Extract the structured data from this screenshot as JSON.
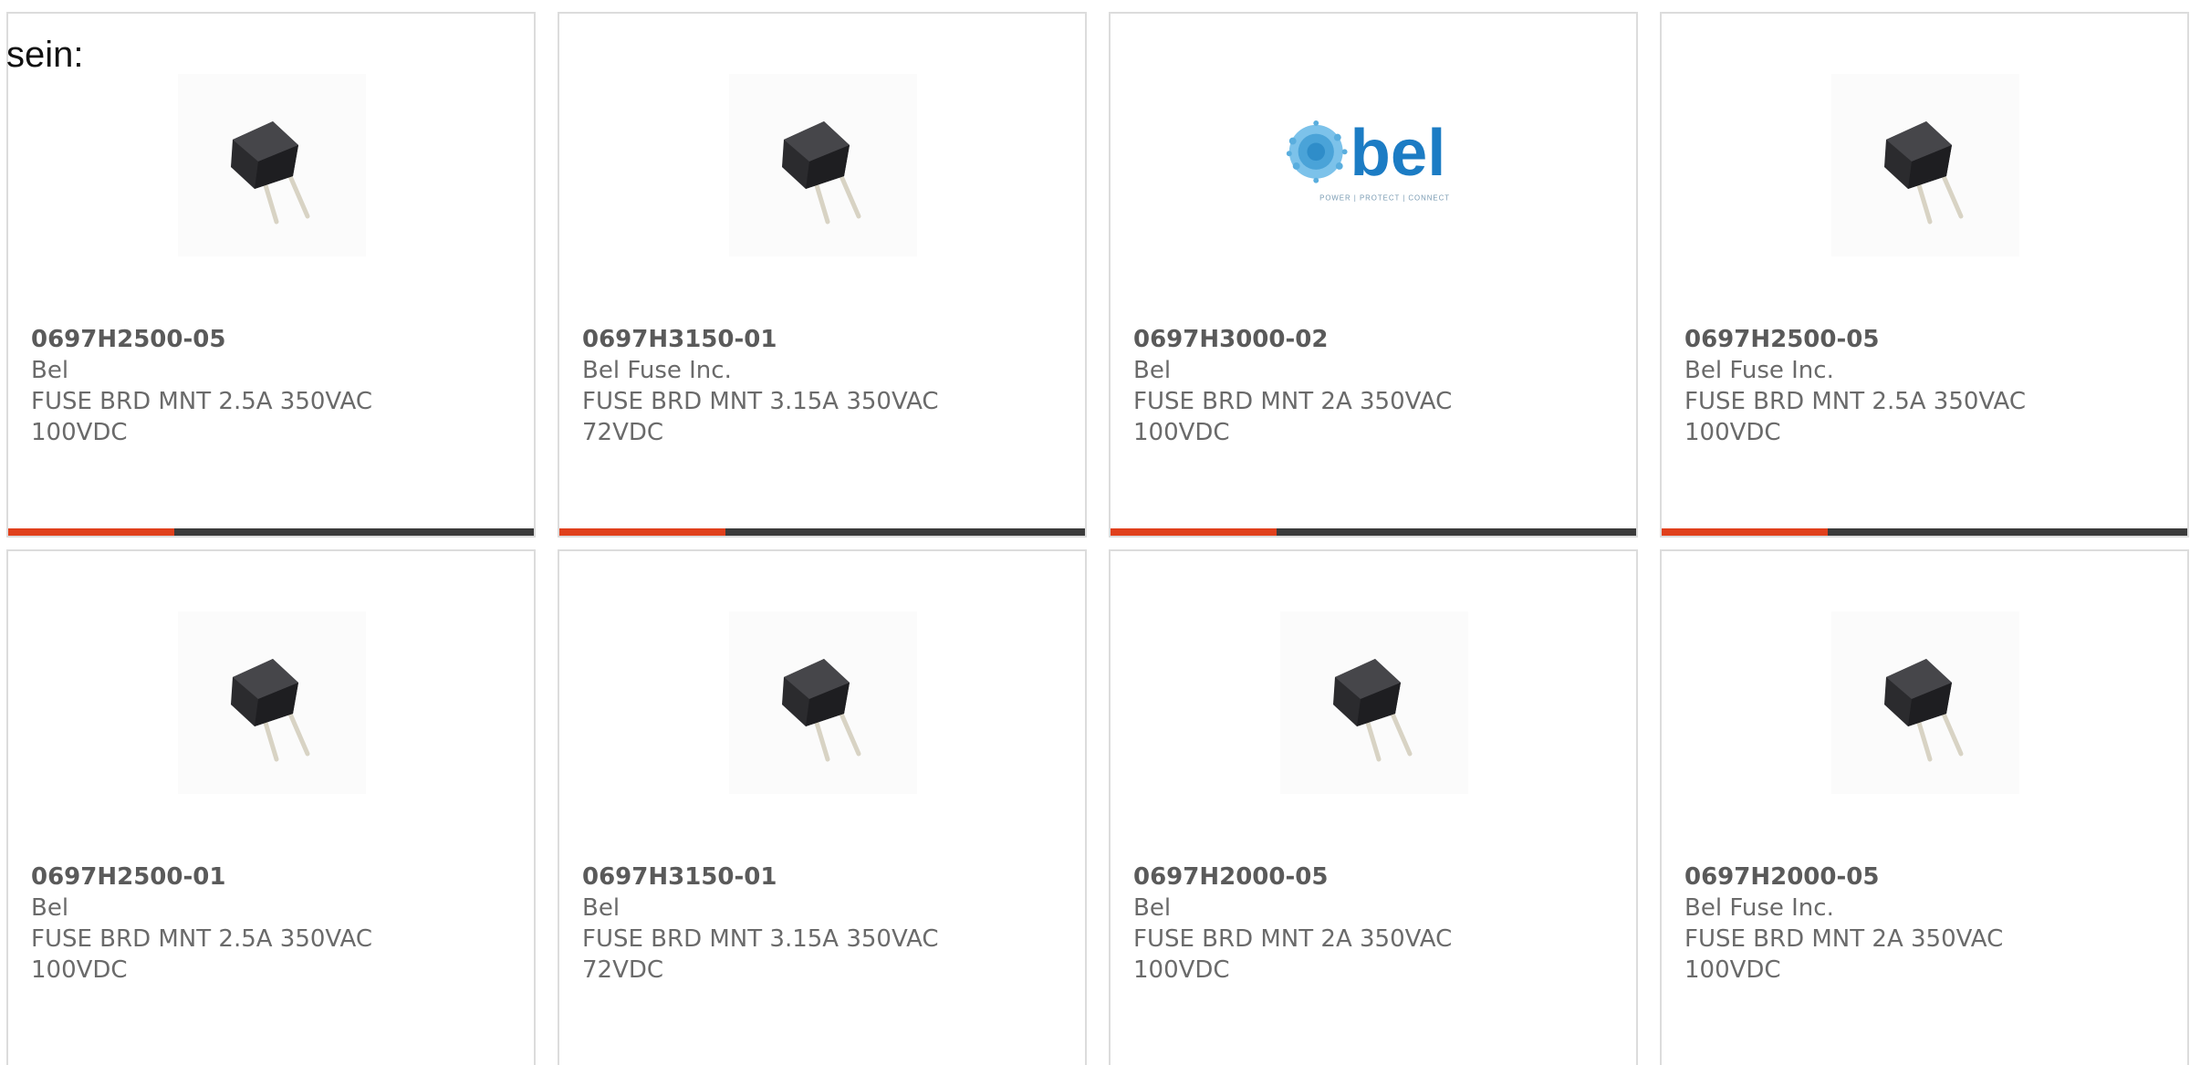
{
  "intro_text": "sein:",
  "colors": {
    "accent": "#e0401c",
    "bar_dark": "#3b3b3b",
    "text_gray": "#6a6a6a",
    "bel_blue": "#1c7cc4"
  },
  "products": [
    {
      "part": "0697H2500-05",
      "maker": "Bel",
      "desc1": "FUSE BRD MNT 2.5A 350VAC",
      "desc2": "100VDC",
      "image": "fuse-image"
    },
    {
      "part": "0697H3150-01",
      "maker": "Bel Fuse Inc.",
      "desc1": "FUSE BRD MNT 3.15A 350VAC",
      "desc2": "72VDC",
      "image": "fuse-image"
    },
    {
      "part": "0697H3000-02",
      "maker": "Bel",
      "desc1": "FUSE BRD MNT 2A 350VAC",
      "desc2": "100VDC",
      "image": "bel-logo",
      "logo_text": "bel",
      "logo_tagline": "POWER | PROTECT | CONNECT"
    },
    {
      "part": "0697H2500-05",
      "maker": "Bel Fuse Inc.",
      "desc1": "FUSE BRD MNT 2.5A 350VAC",
      "desc2": "100VDC",
      "image": "fuse-image"
    },
    {
      "part": "0697H2500-01",
      "maker": "Bel",
      "desc1": "FUSE BRD MNT 2.5A 350VAC",
      "desc2": "100VDC",
      "image": "fuse-image"
    },
    {
      "part": "0697H3150-01",
      "maker": "Bel",
      "desc1": "FUSE BRD MNT 3.15A 350VAC",
      "desc2": "72VDC",
      "image": "fuse-image"
    },
    {
      "part": "0697H2000-05",
      "maker": "Bel",
      "desc1": "FUSE BRD MNT 2A 350VAC",
      "desc2": "100VDC",
      "image": "fuse-image"
    },
    {
      "part": "0697H2000-05",
      "maker": "Bel Fuse Inc.",
      "desc1": "FUSE BRD MNT 2A 350VAC",
      "desc2": "100VDC",
      "image": "fuse-image"
    }
  ]
}
